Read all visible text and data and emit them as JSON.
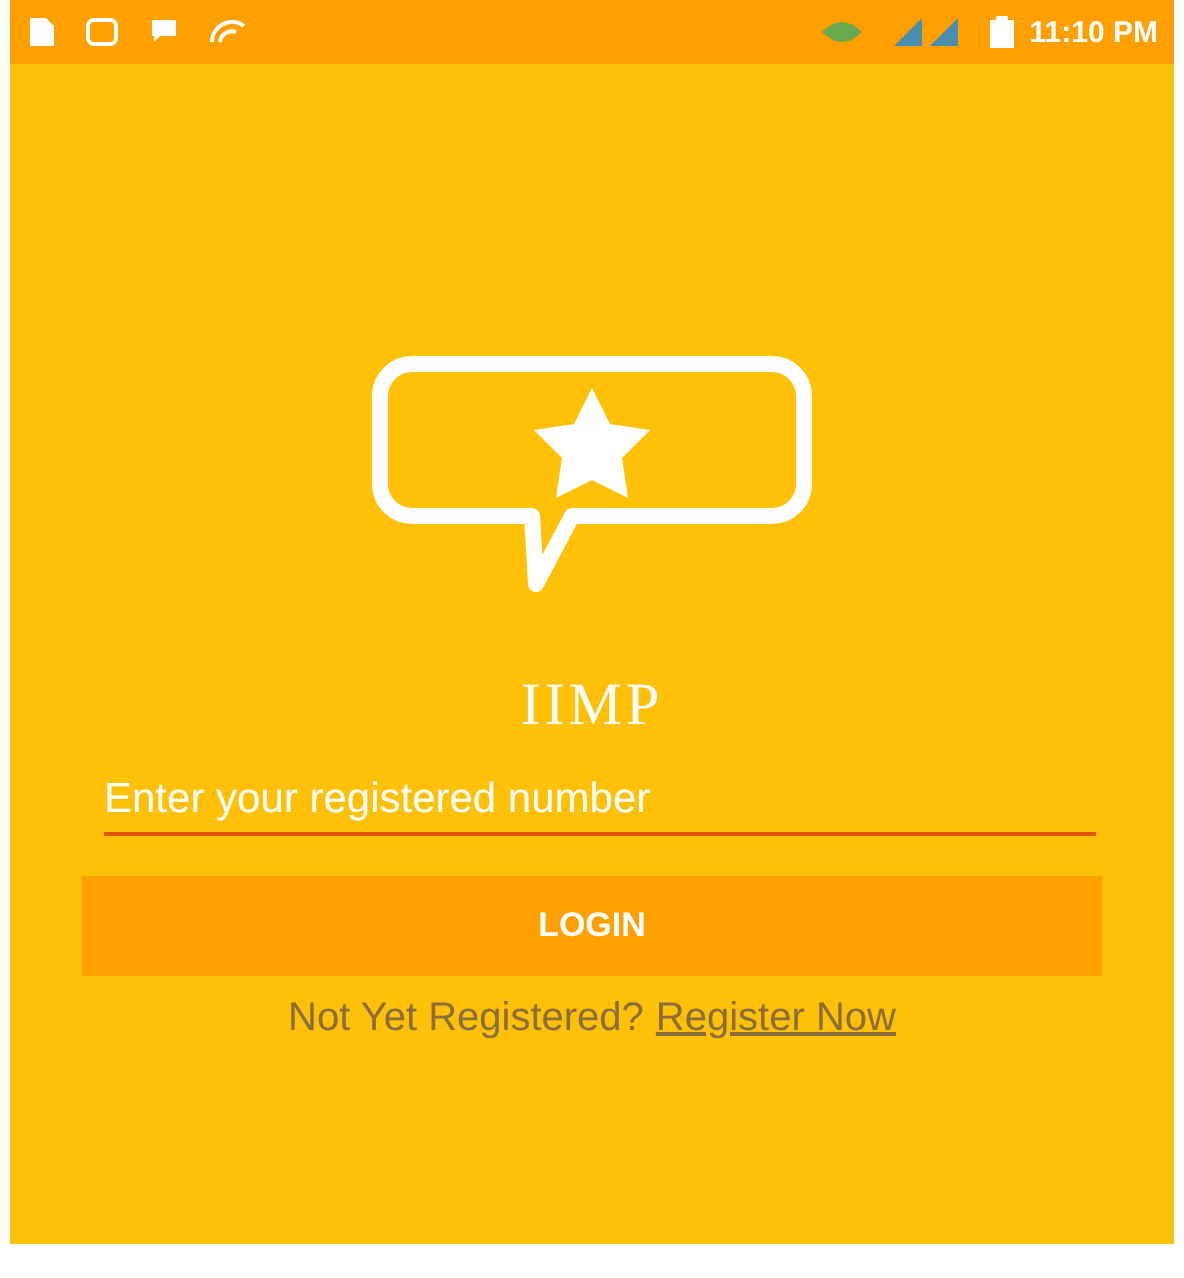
{
  "status_bar": {
    "time": "11:10 PM"
  },
  "app": {
    "title": "IIMP"
  },
  "login_form": {
    "phone_field": {
      "placeholder": "Enter your registered number"
    },
    "login_button": "LOGIN",
    "register_prompt": {
      "text": "Not Yet Registered?",
      "link": "Register Now"
    }
  }
}
